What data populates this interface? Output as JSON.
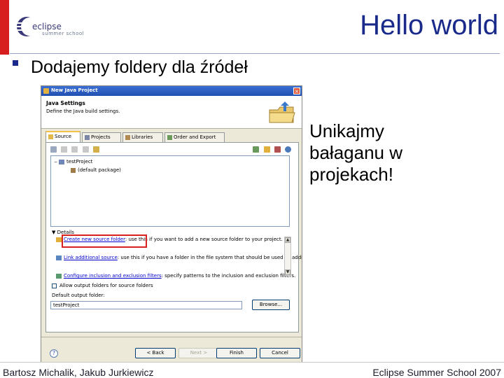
{
  "slide": {
    "title": "Hello world",
    "logo_text": "summer school",
    "bullet": "Dodajemy foldery dla źródeł",
    "side_note": "Unikajmy bałaganu w projekach!",
    "footer_left": "Bartosz Michalik, Jakub Jurkiewicz",
    "footer_right": "Eclipse Summer School 2007"
  },
  "colors": {
    "slide_red": "#d81f1f",
    "slide_blue": "#1a2a8a",
    "highlight_red": "#d82020",
    "titlebar_blue": "#1f4fb0"
  },
  "dialog": {
    "title": "New Java Project",
    "header_title": "Java Settings",
    "header_desc": "Define the Java build settings.",
    "tabs": [
      {
        "label": "Source",
        "icon": "source-folder-icon"
      },
      {
        "label": "Projects",
        "icon": "projects-icon"
      },
      {
        "label": "Libraries",
        "icon": "libraries-icon"
      },
      {
        "label": "Order and Export",
        "icon": "order-export-icon"
      }
    ],
    "tree": {
      "project": "testProject",
      "package": "(default package)"
    },
    "details_label": "Details",
    "details_links": [
      {
        "link": "Create new source folder",
        "text": ": use this if you want to add a new source folder to your project."
      },
      {
        "link": "Link additional source",
        "text": ": use this if you have a folder in the file system that should be used as additional source folder."
      },
      {
        "link": "Configure inclusion and exclusion filters",
        "text": ": specify patterns to the inclusion and exclusion filters."
      }
    ],
    "allow_output_label": "Allow output folders for source folders",
    "default_output_label": "Default output folder:",
    "default_output_value": "testProject",
    "browse_label": "Browse...",
    "buttons": {
      "back": "< Back",
      "next": "Next >",
      "finish": "Finish",
      "cancel": "Cancel"
    }
  }
}
